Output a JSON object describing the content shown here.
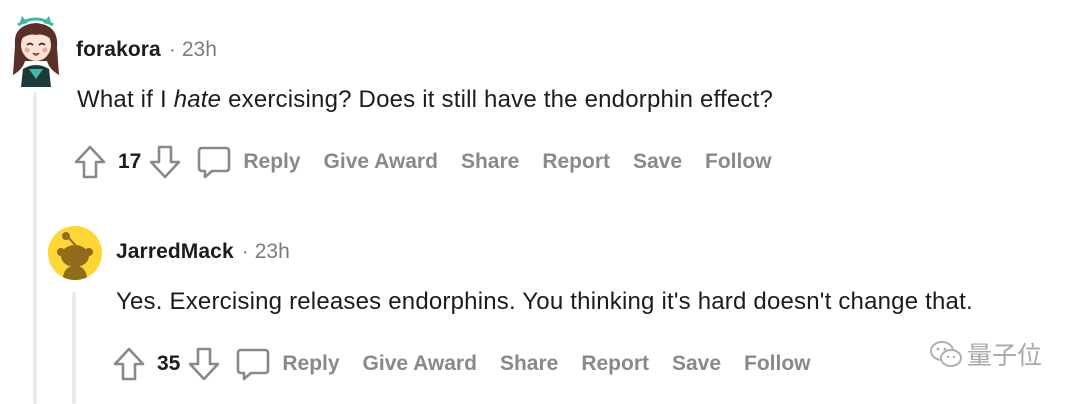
{
  "comments": [
    {
      "username": "forakora",
      "separator": "·",
      "time": "23h",
      "body_before": "What if I ",
      "body_emphasis": "hate",
      "body_after": " exercising? Does it still have the endorphin effect?",
      "votes": "17",
      "actions": [
        "Reply",
        "Give Award",
        "Share",
        "Report",
        "Save",
        "Follow"
      ]
    },
    {
      "username": "JarredMack",
      "separator": "·",
      "time": "23h",
      "body": "Yes. Exercising releases endorphins. You thinking it's hard doesn't change that.",
      "votes": "35",
      "actions": [
        "Reply",
        "Give Award",
        "Share",
        "Report",
        "Save",
        "Follow"
      ]
    }
  ],
  "watermark": {
    "text": "量子位"
  },
  "colors": {
    "action_gray": "#878a8c",
    "text": "#1c1c1c",
    "meta": "#7c7c7c",
    "thread": "#e9ecef",
    "snoo_yellow": "#ffd635"
  }
}
